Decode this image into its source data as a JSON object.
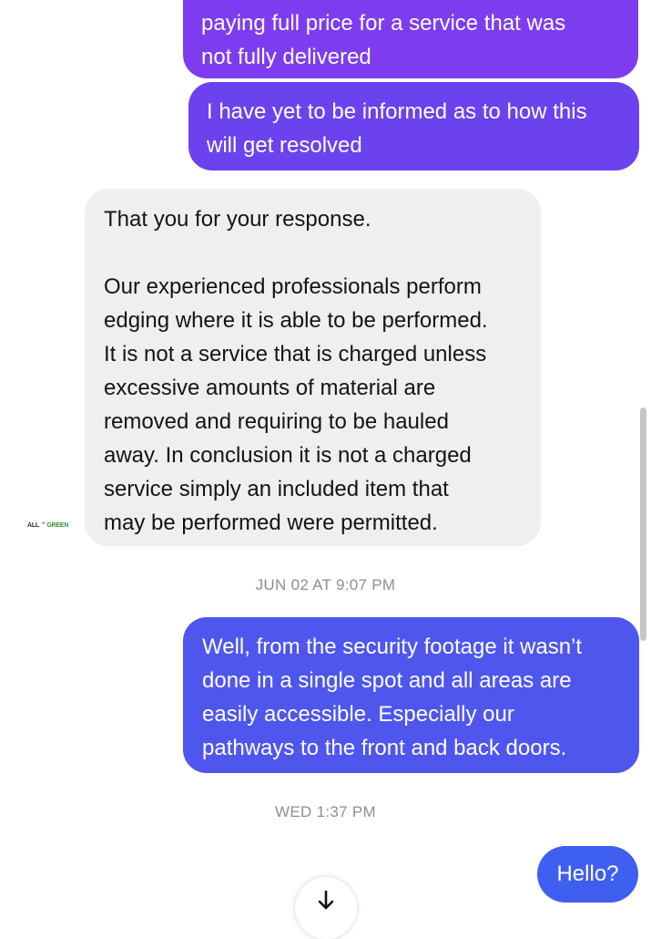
{
  "messages": [
    {
      "direction": "outgoing",
      "lines": [
        "paying full price for a service that was",
        "not fully delivered"
      ]
    },
    {
      "direction": "outgoing",
      "lines": [
        "I have yet to be informed as to how this",
        "will get resolved"
      ]
    },
    {
      "direction": "incoming",
      "sender_logo": {
        "part1": "ALL",
        "part2": "GREEN"
      },
      "paragraph1": [
        "That you for your response."
      ],
      "paragraph2": [
        "Our experienced professionals perform",
        "edging where it is able to be performed.",
        "It is not a service that is charged unless",
        "excessive amounts of material are",
        "removed and requiring to be hauled",
        "away. In conclusion it is not a charged",
        "service simply an included item that",
        "may be performed were permitted."
      ]
    },
    {
      "timestamp": "JUN 02 AT 9:07 PM"
    },
    {
      "direction": "outgoing",
      "lines": [
        "Well, from the security footage it wasn’t",
        "done in a single spot and all areas are",
        "easily accessible. Especially our",
        "pathways to the front and back doors."
      ]
    },
    {
      "timestamp": "WED 1:37 PM"
    },
    {
      "direction": "outgoing",
      "lines": [
        "Hello?"
      ]
    }
  ],
  "icons": {
    "scroll_down": "arrow-down-icon",
    "logo": "allgreen-logo-icon"
  },
  "colors": {
    "outgoing_purple": "#7e3cf0",
    "outgoing_violet": "#6c42ee",
    "outgoing_indigo": "#4f56ee",
    "outgoing_blue": "#3f5ff0",
    "incoming_gray": "#efeff0",
    "timestamp_gray": "#8e8e93"
  }
}
